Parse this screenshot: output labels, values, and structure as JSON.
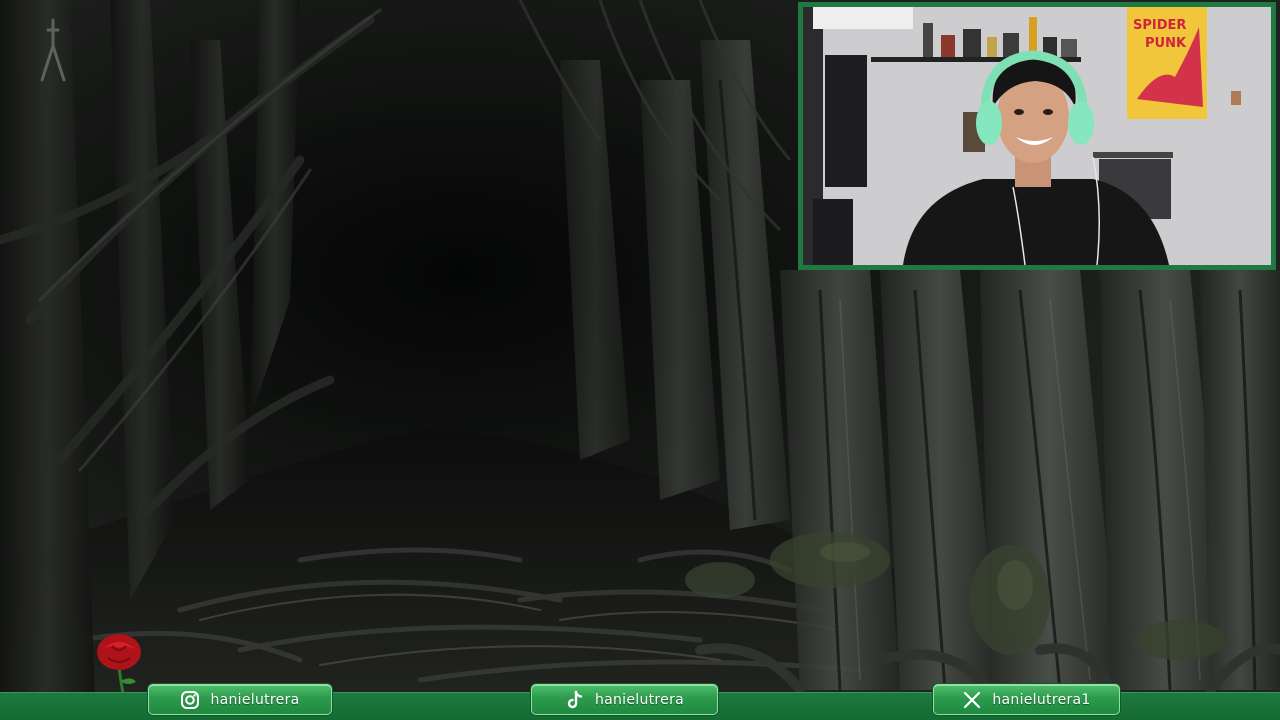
{
  "scene": {
    "description_colors": {
      "forest_dark": "#0d0e0d",
      "forest_mid": "#3c403b",
      "foliage": "#4d5a3f"
    }
  },
  "webcam": {
    "poster_text_line1": "SPIDER",
    "poster_text_line2": "PUNK",
    "border_color": "#1f7a41"
  },
  "socials": {
    "instagram": {
      "icon": "instagram-icon",
      "handle": "hanielutrera"
    },
    "tiktok": {
      "icon": "tiktok-icon",
      "handle": "hanielutrera"
    },
    "x": {
      "icon": "x-icon",
      "handle": "hanielutrera1"
    }
  },
  "theme": {
    "accent": "#1f7a41",
    "pill_top": "#4fbf6c",
    "pill_bottom": "#1f8a40",
    "text": "#ffffff"
  }
}
